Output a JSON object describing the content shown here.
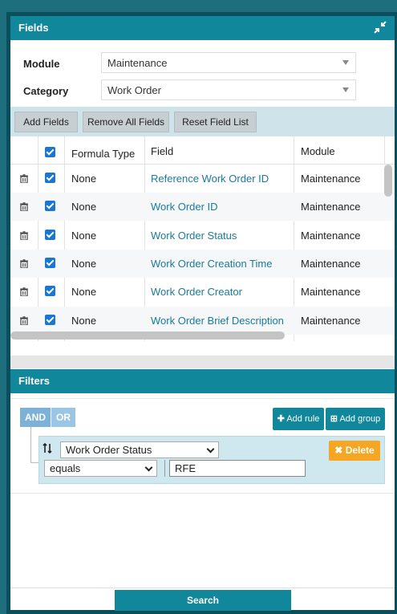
{
  "fields_panel": {
    "title": "Fields",
    "module_label": "Module",
    "module_value": "Maintenance",
    "category_label": "Category",
    "category_value": "Work Order"
  },
  "toolbar": {
    "add_fields": "Add Fields",
    "remove_all": "Remove All Fields",
    "reset_list": "Reset Field List"
  },
  "table": {
    "columns": [
      "",
      "",
      "Formula Type",
      "Field",
      "Module"
    ],
    "rows": [
      {
        "formula": "None",
        "field": "Reference Work Order ID",
        "module": "Maintenance"
      },
      {
        "formula": "None",
        "field": "Work Order ID",
        "module": "Maintenance"
      },
      {
        "formula": "None",
        "field": "Work Order Status",
        "module": "Maintenance"
      },
      {
        "formula": "None",
        "field": "Work Order Creation Time",
        "module": "Maintenance"
      },
      {
        "formula": "None",
        "field": "Work Order Creator",
        "module": "Maintenance"
      },
      {
        "formula": "None",
        "field": "Work Order Brief Description",
        "module": "Maintenance"
      }
    ]
  },
  "filters": {
    "title": "Filters",
    "and_label": "AND",
    "or_label": "OR",
    "add_rule": "Add rule",
    "add_group": "Add group",
    "rule_field": "Work Order Status",
    "rule_operator": "equals",
    "rule_value": "RFE",
    "delete_label": "Delete"
  },
  "search_label": "Search",
  "colors": {
    "teal": "#10879a",
    "dark_teal": "#0b4f5c",
    "link": "#1a7a9a",
    "delete": "#f5a623"
  }
}
